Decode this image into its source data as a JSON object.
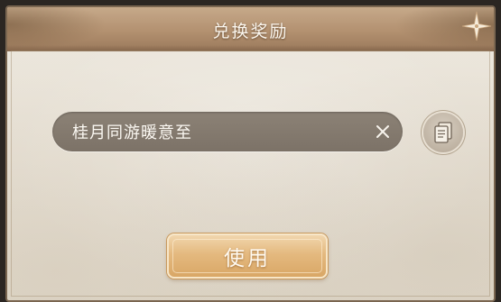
{
  "dialog": {
    "title": "兑换奖励",
    "code_field": {
      "value": "桂月同游暖意至",
      "clear_icon": "close-icon"
    },
    "paste_icon": "clipboard-icon",
    "use_button_label": "使用",
    "colors": {
      "header": "#b39170",
      "panel": "#ebe6dc",
      "field": "#847a6f",
      "button": "#e4b97f"
    }
  }
}
